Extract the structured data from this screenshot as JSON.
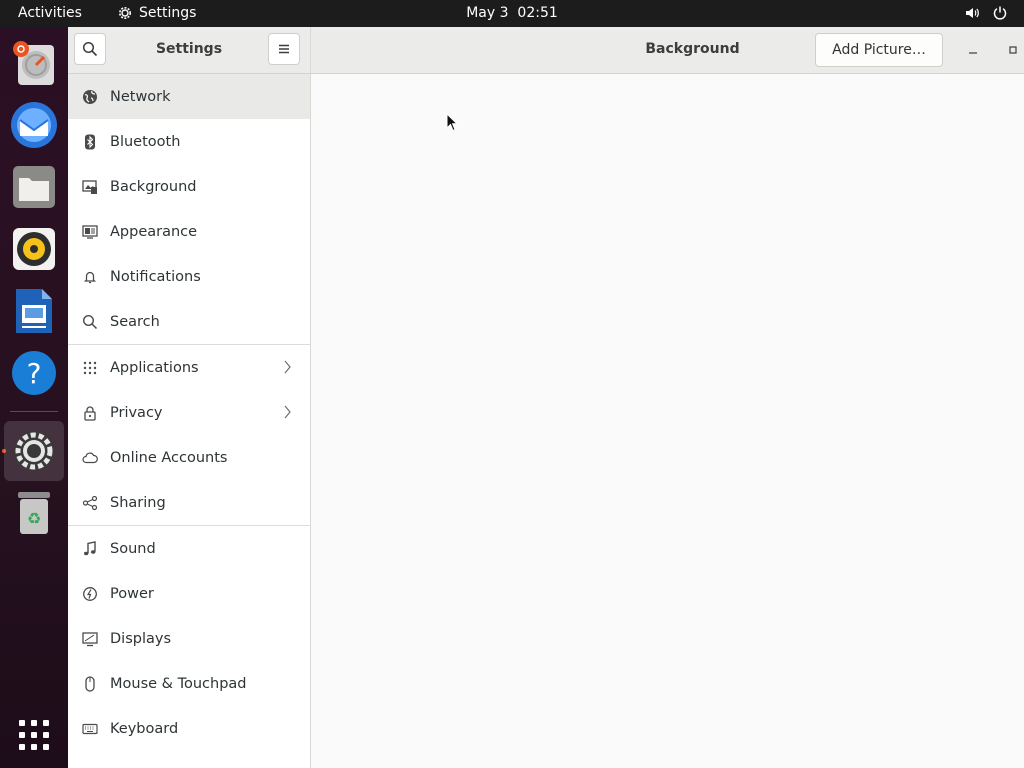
{
  "topbar": {
    "activities_label": "Activities",
    "app_name": "Settings",
    "date": "May 3",
    "time": "02:51"
  },
  "dock": {
    "items": [
      {
        "name": "Disk Usage Analyzer",
        "icon": "disk-analyzer-icon"
      },
      {
        "name": "Thunderbird Mail",
        "icon": "thunderbird-icon"
      },
      {
        "name": "Files",
        "icon": "files-icon"
      },
      {
        "name": "Rhythmbox",
        "icon": "rhythmbox-icon"
      },
      {
        "name": "LibreOffice Writer",
        "icon": "writer-icon"
      },
      {
        "name": "Help",
        "icon": "help-icon"
      },
      {
        "name": "Settings",
        "icon": "settings-icon",
        "active": true
      },
      {
        "name": "Trash",
        "icon": "trash-icon"
      },
      {
        "name": "Show Applications",
        "icon": "app-grid-icon"
      }
    ]
  },
  "sidebar": {
    "title": "Settings",
    "items": [
      {
        "label": "Network",
        "icon": "network-icon",
        "selected": true
      },
      {
        "label": "Bluetooth",
        "icon": "bluetooth-icon"
      },
      {
        "label": "Background",
        "icon": "background-icon"
      },
      {
        "label": "Appearance",
        "icon": "appearance-icon"
      },
      {
        "label": "Notifications",
        "icon": "bell-icon"
      },
      {
        "label": "Search",
        "icon": "search-icon"
      },
      {
        "label": "Applications",
        "icon": "apps-grid-icon",
        "chevron": true
      },
      {
        "label": "Privacy",
        "icon": "lock-icon",
        "chevron": true
      },
      {
        "label": "Online Accounts",
        "icon": "cloud-icon"
      },
      {
        "label": "Sharing",
        "icon": "share-icon"
      },
      {
        "label": "Sound",
        "icon": "music-note-icon"
      },
      {
        "label": "Power",
        "icon": "power-icon"
      },
      {
        "label": "Displays",
        "icon": "display-icon"
      },
      {
        "label": "Mouse & Touchpad",
        "icon": "mouse-icon"
      },
      {
        "label": "Keyboard",
        "icon": "keyboard-icon"
      }
    ]
  },
  "content": {
    "title": "Background",
    "add_picture_label": "Add Picture…"
  },
  "colors": {
    "accent": "#e95420",
    "topbar_bg": "#1c1c1c",
    "dock_bg": "#2b0f24",
    "header_bg": "#ebebe9"
  }
}
